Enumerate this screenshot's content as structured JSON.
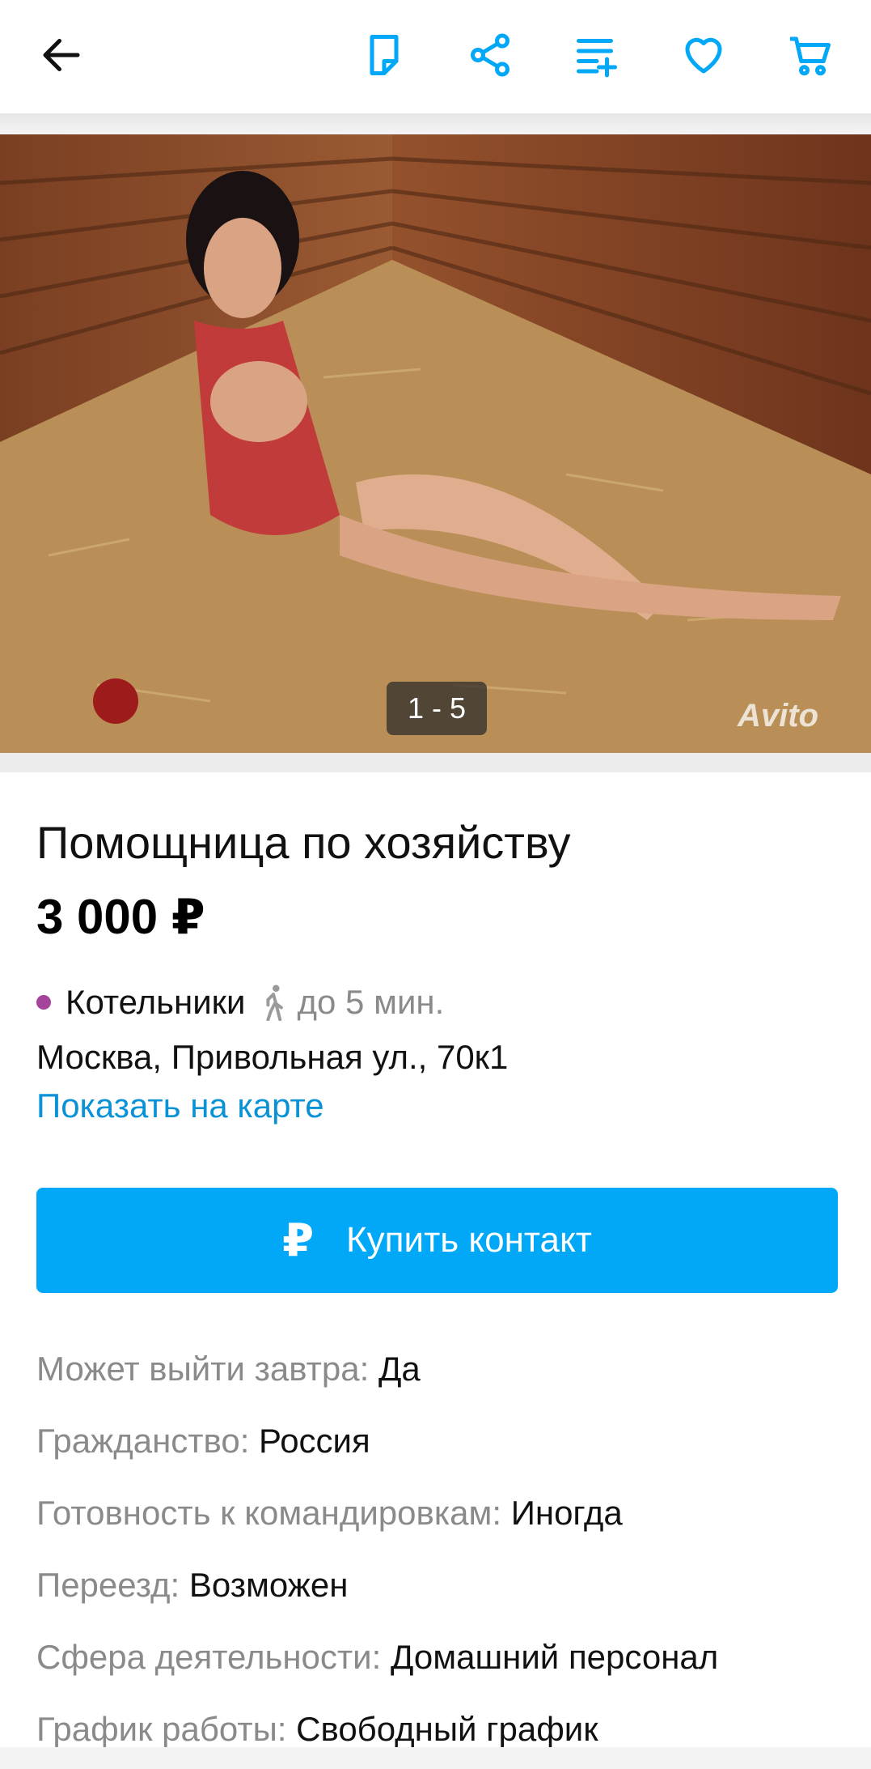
{
  "header": {
    "icons": [
      "back-arrow-icon",
      "note-icon",
      "share-icon",
      "compare-list-icon",
      "heart-icon",
      "cart-icon"
    ],
    "accent_color": "#00a8f7"
  },
  "gallery": {
    "counter": "1 - 5",
    "watermark": "Avito"
  },
  "listing": {
    "title": "Помощница по хозяйству",
    "price": "3 000 ₽"
  },
  "location": {
    "metro_station": "Котельники",
    "metro_color": "#a4449b",
    "walk_time": "до 5 мин.",
    "address": "Москва, Привольная ул., 70к1",
    "map_link": "Показать на карте"
  },
  "buy_button": {
    "icon": "₽",
    "label": "Купить контакт"
  },
  "params": [
    {
      "key": "Может выйти завтра:",
      "value": "Да"
    },
    {
      "key": "Гражданство:",
      "value": "Россия"
    },
    {
      "key": "Готовность к командировкам:",
      "value": "Иногда"
    },
    {
      "key": "Переезд:",
      "value": "Возможен"
    },
    {
      "key": "Сфера деятельности:",
      "value": "Домашний персонал"
    },
    {
      "key": "График работы:",
      "value": "Свободный график"
    }
  ]
}
